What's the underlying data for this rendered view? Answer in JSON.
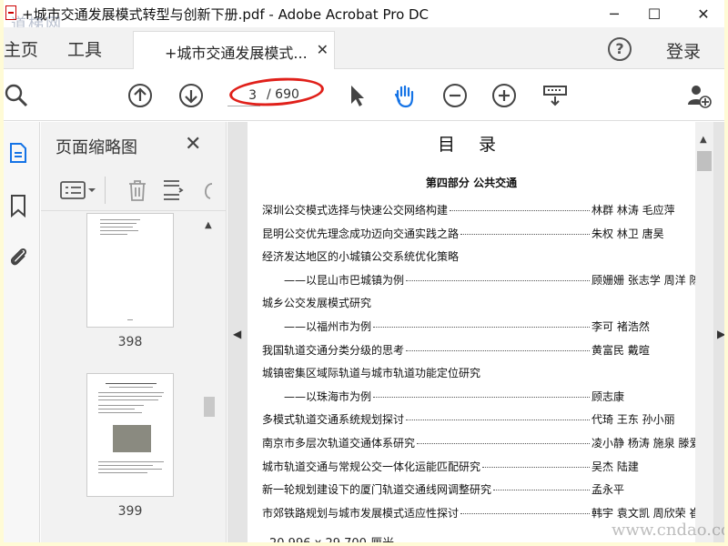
{
  "window": {
    "title": "+城市交通发展模式转型与创新下册.pdf - Adobe Acrobat Pro DC",
    "watermark_top": "道梯网",
    "minimize": "─",
    "maximize": "☐",
    "close": "✕"
  },
  "tabs": {
    "home": "主页",
    "tools": "工具",
    "doc_tab": "+城市交通发展模式...",
    "doc_tab_close": "✕",
    "help": "?",
    "login": "登录"
  },
  "toolbar": {
    "current_page": "3",
    "total_pages": "/ 690"
  },
  "thumbnails": {
    "title": "页面缩略图",
    "close": "✕",
    "pages": [
      {
        "label": "398"
      },
      {
        "label": "399"
      }
    ]
  },
  "document": {
    "title": "目 录",
    "part_heading": "第四部分 公共交通",
    "page_size": "20.996 x 29.700 厘米",
    "entries": [
      {
        "title": "深圳公交模式选择与快速公交网络构建",
        "authors": "林群 林涛 毛应萍"
      },
      {
        "title": "昆明公交优先理念成功迈向交通实践之路",
        "authors": "朱权 林卫 唐昊"
      },
      {
        "title": "经济发达地区的小城镇公交系统优化策略",
        "authors": ""
      },
      {
        "title": "——以昆山市巴城镇为例",
        "authors": "顾姗姗 张志学 周洋 陈亚红"
      },
      {
        "title": "城乡公交发展模式研究",
        "authors": ""
      },
      {
        "title": "——以福州市为例",
        "authors": "李可 褚浩然"
      },
      {
        "title": "我国轨道交通分类分级的思考",
        "authors": "黄富民 戴暄"
      },
      {
        "title": "城镇密集区域际轨道与城市轨道功能定位研究",
        "authors": ""
      },
      {
        "title": "——以珠海市为例",
        "authors": "顾志康"
      },
      {
        "title": "多模式轨道交通系统规划探讨",
        "authors": "代琦 王东 孙小丽"
      },
      {
        "title": "南京市多层次轨道交通体系研究",
        "authors": "凌小静 杨涛 施泉 滕爱兵"
      },
      {
        "title": "城市轨道交通与常规公交一体化运能匹配研究",
        "authors": "吴杰 陆建"
      },
      {
        "title": "新一轮规划建设下的厦门轨道交通线网调整研究",
        "authors": "孟永平"
      },
      {
        "title": "市郊铁路规划与城市发展模式适应性探讨",
        "authors": "韩宇 袁文凯 周欣荣 崔扬"
      }
    ]
  },
  "watermark_bottom": "www.cndao.com",
  "colors": {
    "annotation_red": "#e0201a",
    "hand_tool_blue": "#1473e6",
    "outer_background": "#fffbd6"
  }
}
